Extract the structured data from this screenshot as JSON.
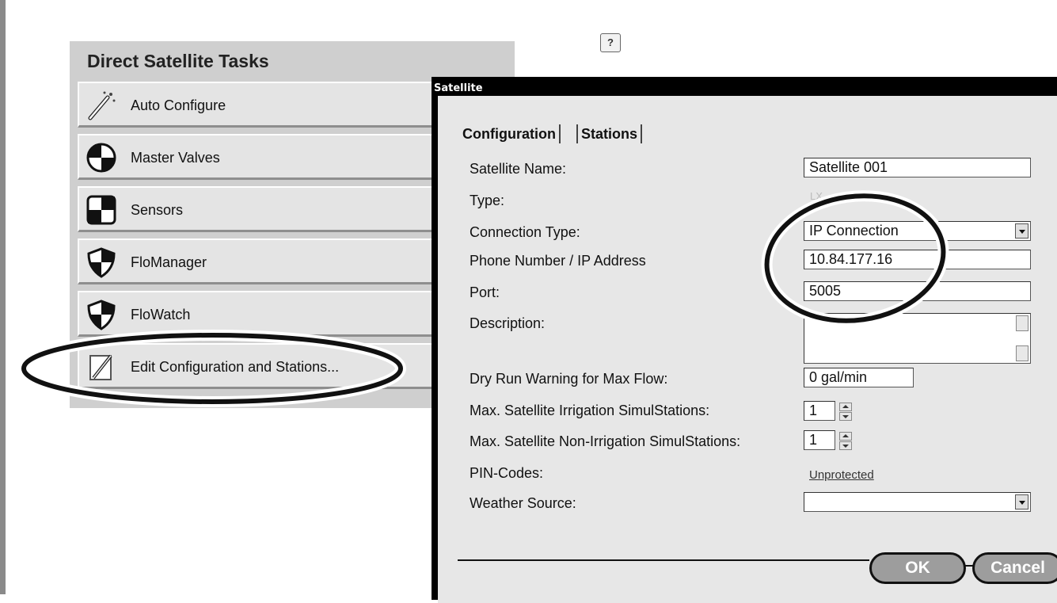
{
  "tasks_panel": {
    "title": "Direct Satellite Tasks",
    "items": [
      {
        "label": "Auto Configure",
        "icon": "magic-wand-icon"
      },
      {
        "label": "Master Valves",
        "icon": "valve-icon"
      },
      {
        "label": "Sensors",
        "icon": "sensor-icon"
      },
      {
        "label": "FloManager",
        "icon": "shield-icon"
      },
      {
        "label": "FloWatch",
        "icon": "shield-icon"
      },
      {
        "label": "Edit Configuration and Stations...",
        "icon": "pencil-icon"
      }
    ]
  },
  "dialog": {
    "title": "Satellite",
    "help": "?",
    "tabs": [
      "Configuration",
      "Stations"
    ],
    "fields": {
      "satellite_name": {
        "label": "Satellite Name:",
        "value": "Satellite 001"
      },
      "type": {
        "label": "Type:",
        "value": "LX"
      },
      "connection_type": {
        "label": "Connection Type:",
        "value": "IP Connection"
      },
      "address": {
        "label": "Phone Number / IP Address",
        "value": "10.84.177.16"
      },
      "port": {
        "label": "Port:",
        "value": "5005"
      },
      "description": {
        "label": "Description:",
        "value": ""
      },
      "dry_run": {
        "label": "Dry Run Warning for Max Flow:",
        "value": "0 gal/min"
      },
      "max_irrigation": {
        "label": "Max. Satellite Irrigation SimulStations:",
        "value": "1"
      },
      "max_non_irrigation": {
        "label": "Max. Satellite Non-Irrigation SimulStations:",
        "value": "1"
      },
      "pin_codes": {
        "label": "PIN-Codes:",
        "value": "Unprotected"
      },
      "weather_source": {
        "label": "Weather Source:",
        "value": ""
      }
    },
    "buttons": {
      "ok": "OK",
      "cancel": "Cancel"
    }
  }
}
